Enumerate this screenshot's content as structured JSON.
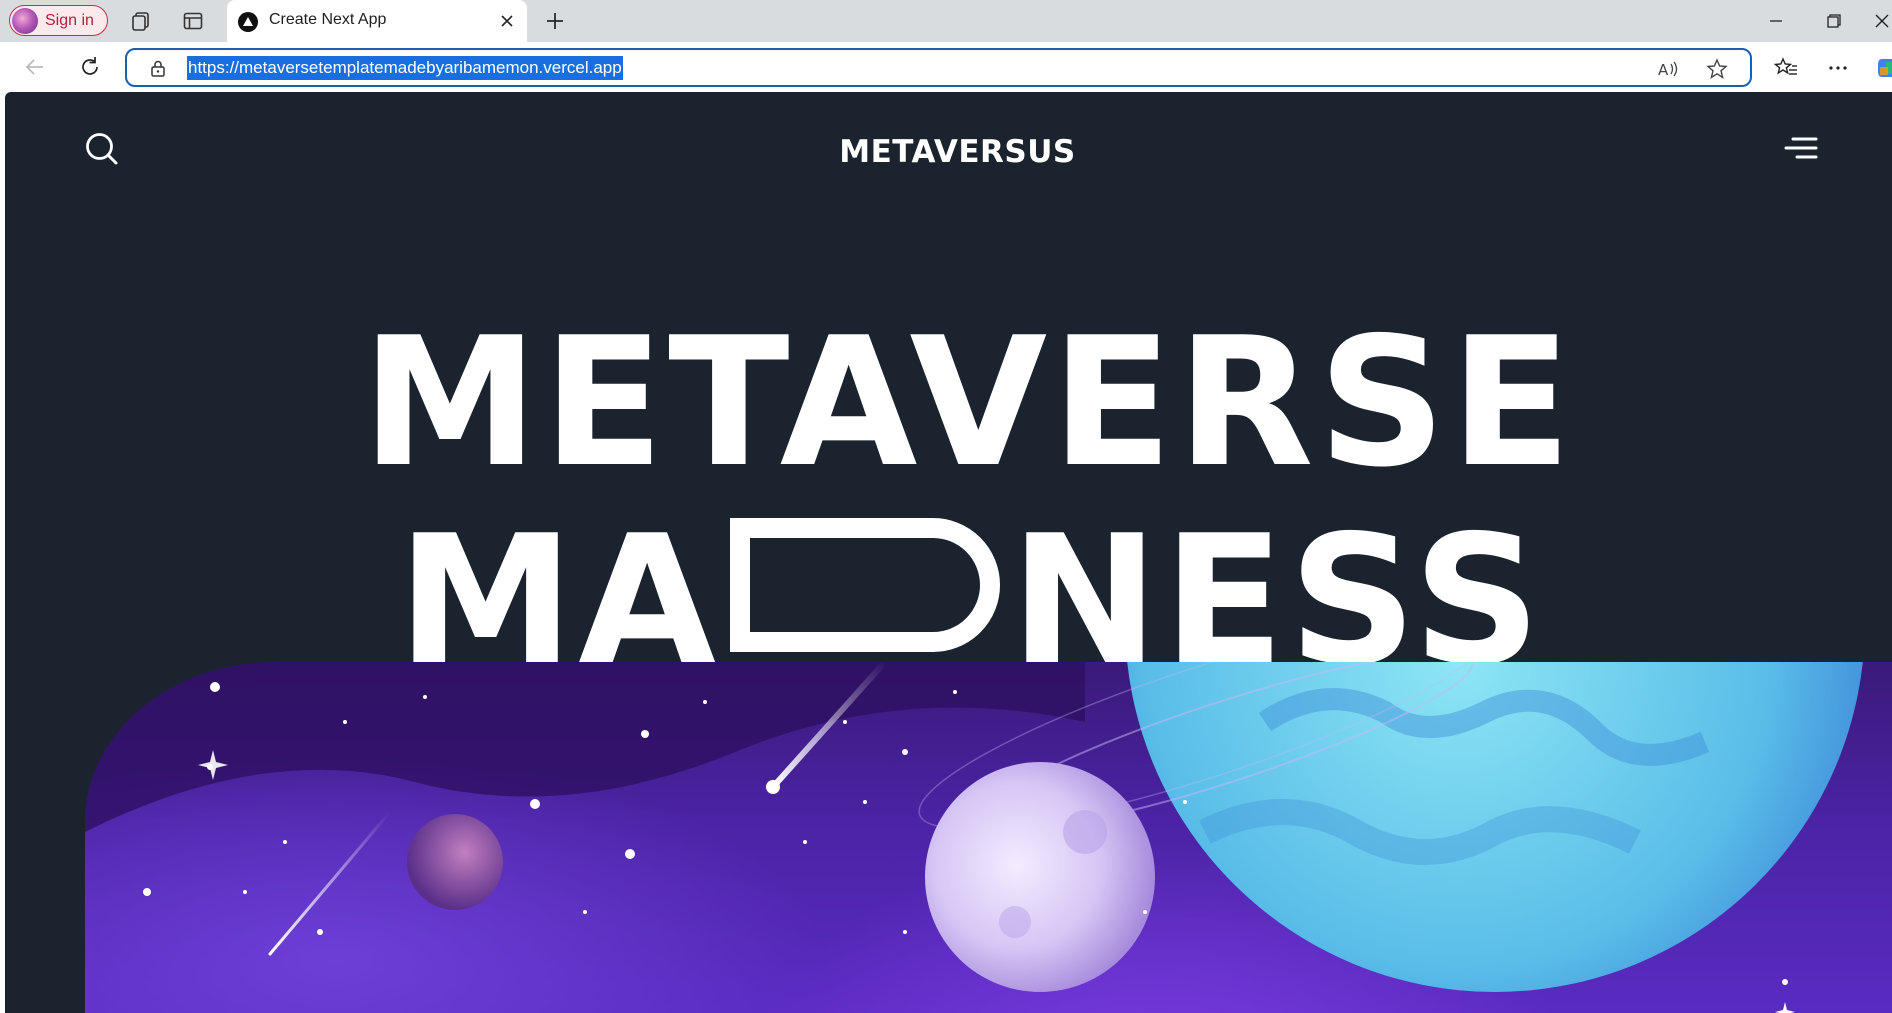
{
  "browser": {
    "signin_label": "Sign in",
    "tab": {
      "title": "Create Next App"
    },
    "address": {
      "url": "https://metaversetemplatemadebyaribamemon.vercel.app"
    },
    "icons": {
      "workspaces": "workspaces-icon",
      "tab_actions": "tab-actions-icon",
      "tab_close": "close-icon",
      "new_tab": "plus-icon",
      "back": "back-arrow-icon",
      "refresh": "refresh-icon",
      "lock": "lock-icon",
      "read_aloud": "read-aloud-icon",
      "favorite": "star-icon",
      "favorites": "favorites-icon",
      "more": "more-icon",
      "copilot": "copilot-icon",
      "minimize": "minimize-icon",
      "restore": "restore-icon",
      "close_window": "close-window-icon"
    }
  },
  "site": {
    "brand": "METAVERSUS",
    "hero": {
      "line1": "METAVERSE",
      "line2_left": "MA",
      "line2_right": "NESS"
    },
    "colors": {
      "background": "#1a232e",
      "text": "#ffffff",
      "space_purple": "#4b23a4",
      "planet_blue": "#6fd3ee"
    }
  }
}
